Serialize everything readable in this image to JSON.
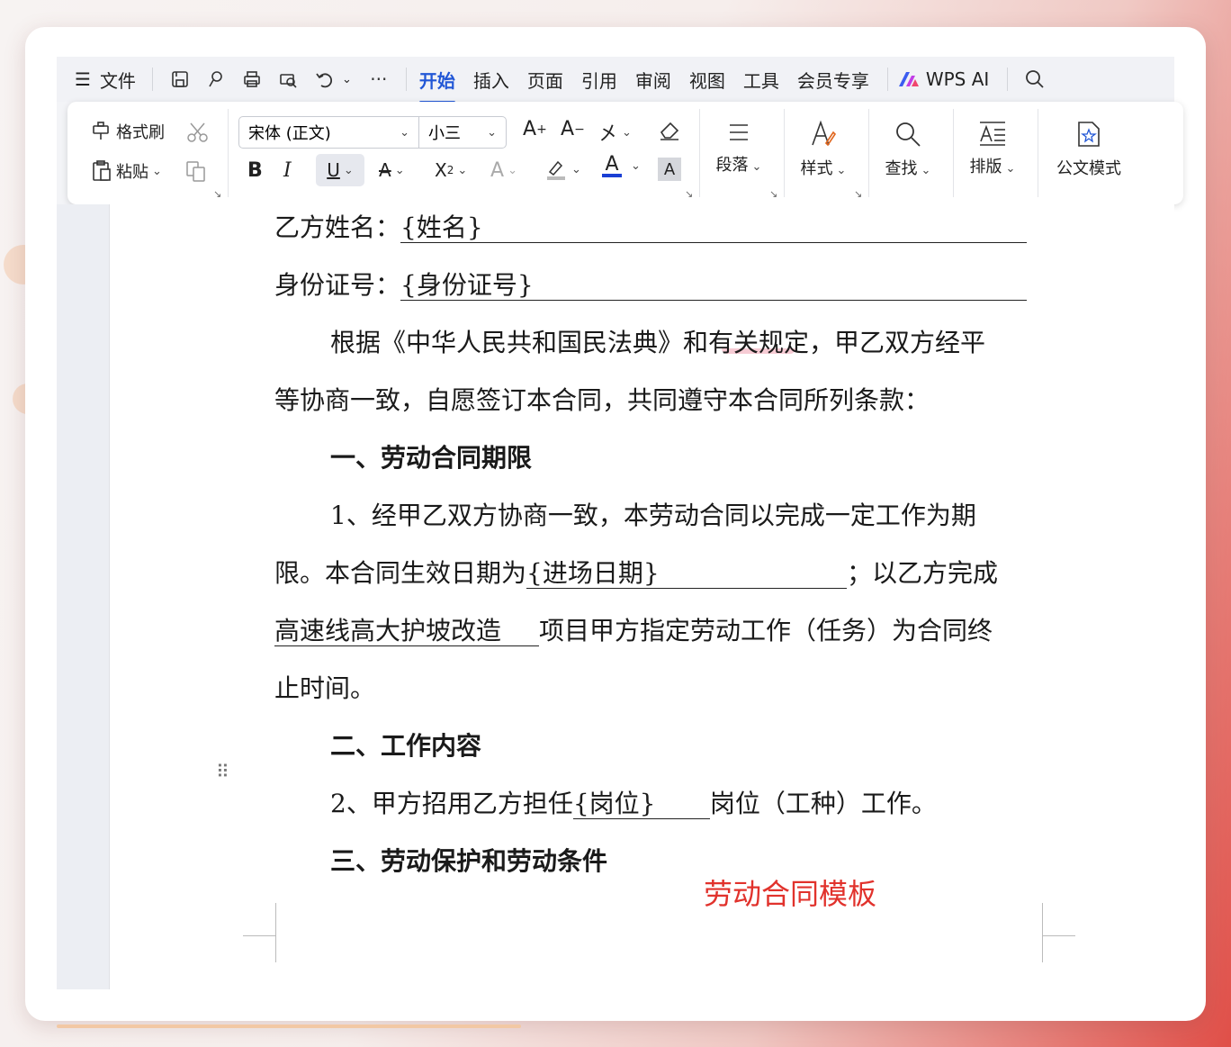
{
  "menubar": {
    "file_label": "文件",
    "tabs": [
      "开始",
      "插入",
      "页面",
      "引用",
      "审阅",
      "视图",
      "工具",
      "会员专享"
    ],
    "active_tab": "开始",
    "ai_label": "WPS AI"
  },
  "ribbon": {
    "format_painter": "格式刷",
    "paste": "粘贴",
    "font_name": "宋体 (正文)",
    "font_size": "小三",
    "paragraph": "段落",
    "styles": "样式",
    "find": "查找",
    "layout": "排版",
    "official_mode": "公文模式"
  },
  "document": {
    "party_b_name_label": "乙方姓名：",
    "party_b_name_value": "{姓名}",
    "id_label": "身份证号：",
    "id_value": "{身份证号}",
    "para1_line1": "根据《中华人民共和国民法典》和有关规定，甲乙双方经平",
    "para1_line2": "等协商一致，自愿签订本合同，共同遵守本合同所列条款：",
    "heading1": "一、劳动合同期限",
    "item1_line1": "1、经甲乙双方协商一致，本劳动合同以完成一定工作为期",
    "item1_line2_a": "限。本合同生效日期为",
    "item1_line2_field": "{进场日期}",
    "item1_line2_b": "；以乙方完成",
    "item1_line3_field": "高速线高大护坡改造",
    "item1_line3_b": "项目甲方指定劳动工作（任务）为合同终",
    "item1_line4": "止时间。",
    "heading2": "二、工作内容",
    "item2_a": "2、甲方招用乙方担任",
    "item2_field": "{岗位}",
    "item2_b": "岗位（工种）工作。",
    "heading3": "三、劳动保护和劳动条件"
  },
  "watermark": "劳动合同模板"
}
